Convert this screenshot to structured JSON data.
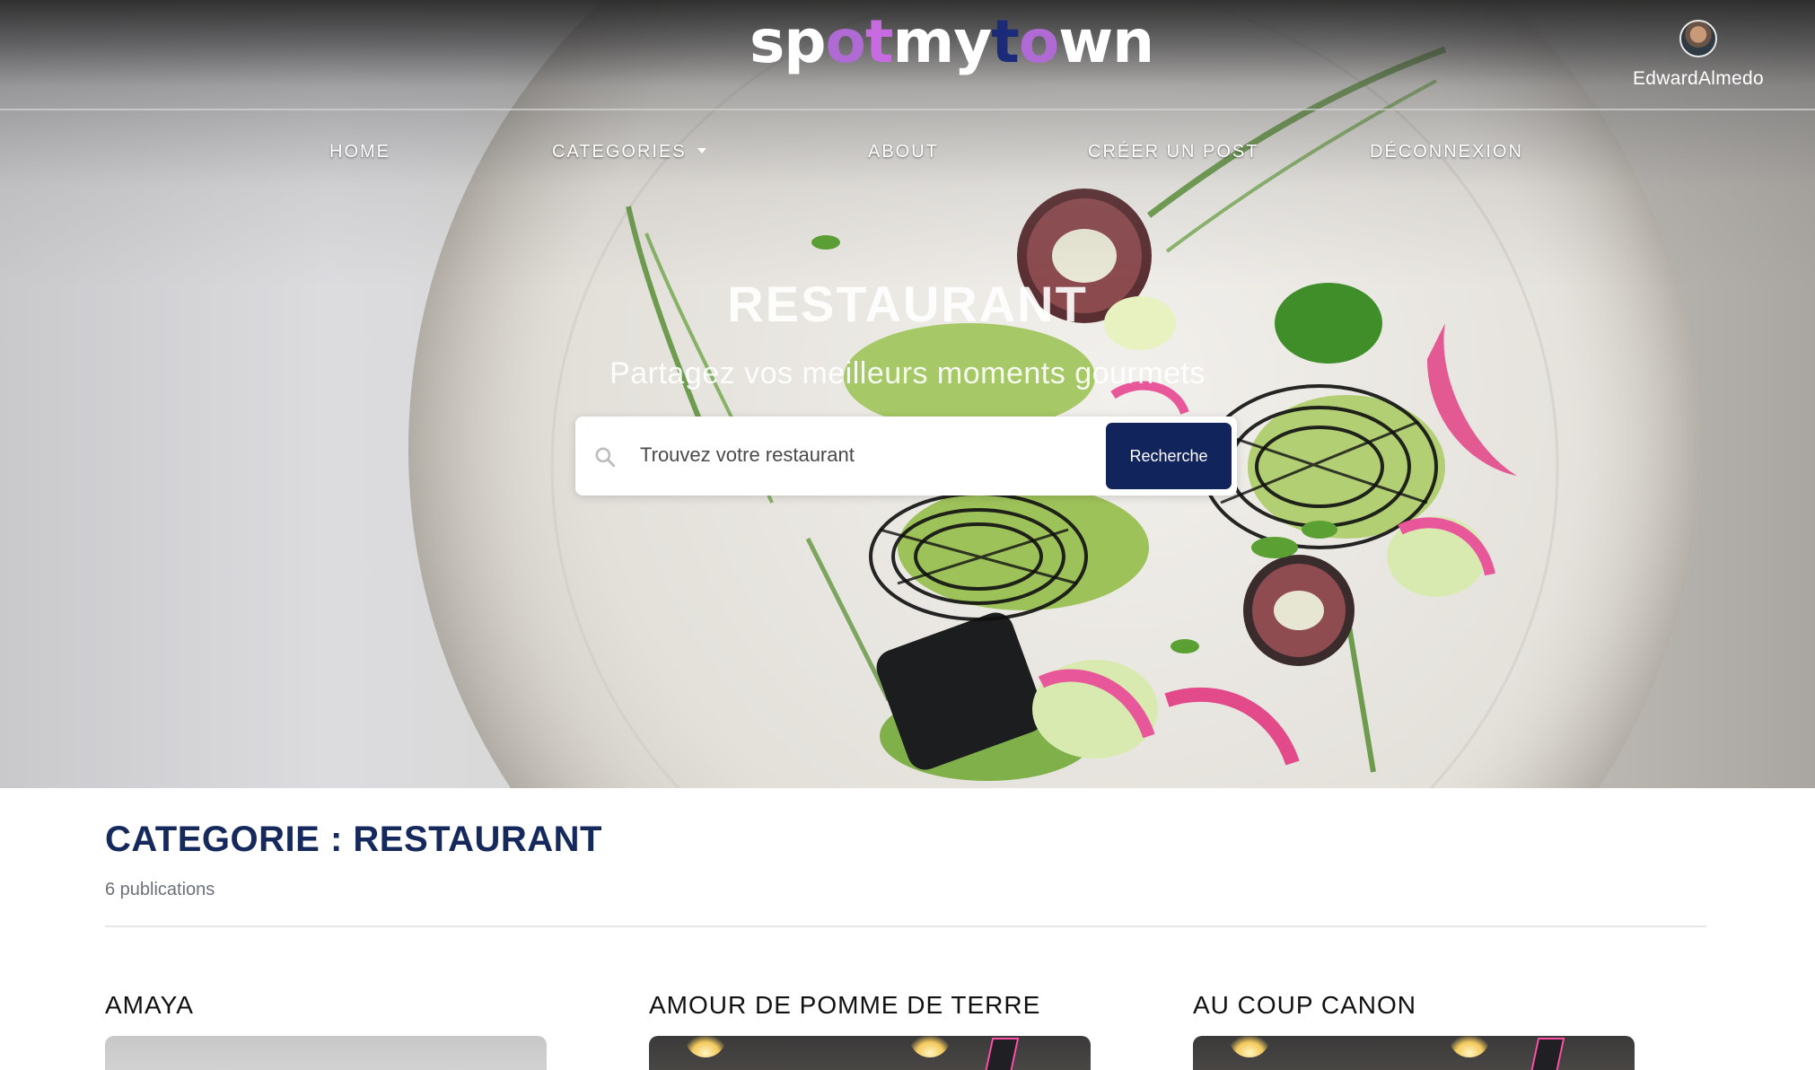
{
  "app": {
    "logo": {
      "letters": [
        "s",
        "p",
        "o",
        "t",
        "m",
        "y",
        "t",
        "o",
        "w",
        "n"
      ],
      "letter_colors": [
        "#ffffff",
        "#ffffff",
        "#b06ad3",
        "#c86be0",
        "#ffffff",
        "#ffffff",
        "#1b2b7a",
        "#b06ad3",
        "#ffffff",
        "#ffffff"
      ]
    },
    "user": {
      "name": "EdwardAlmedo"
    }
  },
  "nav": {
    "items": [
      {
        "label": "HOME"
      },
      {
        "label": "CATEGORIES"
      },
      {
        "label": "ABOUT"
      },
      {
        "label": "CRÉER UN POST"
      },
      {
        "label": "DÉCONNEXION"
      }
    ]
  },
  "hero": {
    "title": "RESTAURANT",
    "subtitle": "Partagez vos meilleurs moments gourmets",
    "search": {
      "placeholder": "Trouvez votre restaurant",
      "button": "Recherche"
    }
  },
  "category": {
    "heading": "CATEGORIE : RESTAURANT",
    "count": "6 publications"
  },
  "posts": [
    {
      "title": "AMAYA"
    },
    {
      "title": "AMOUR DE POMME DE TERRE"
    },
    {
      "title": "AU COUP CANON"
    }
  ],
  "colors": {
    "brand_navy": "#12245c",
    "heading_navy": "#16295c",
    "logo_purple": "#b06ad3",
    "logo_blue": "#1b2b7a"
  },
  "icons": [
    "search-icon",
    "caret-down-icon",
    "avatar"
  ]
}
